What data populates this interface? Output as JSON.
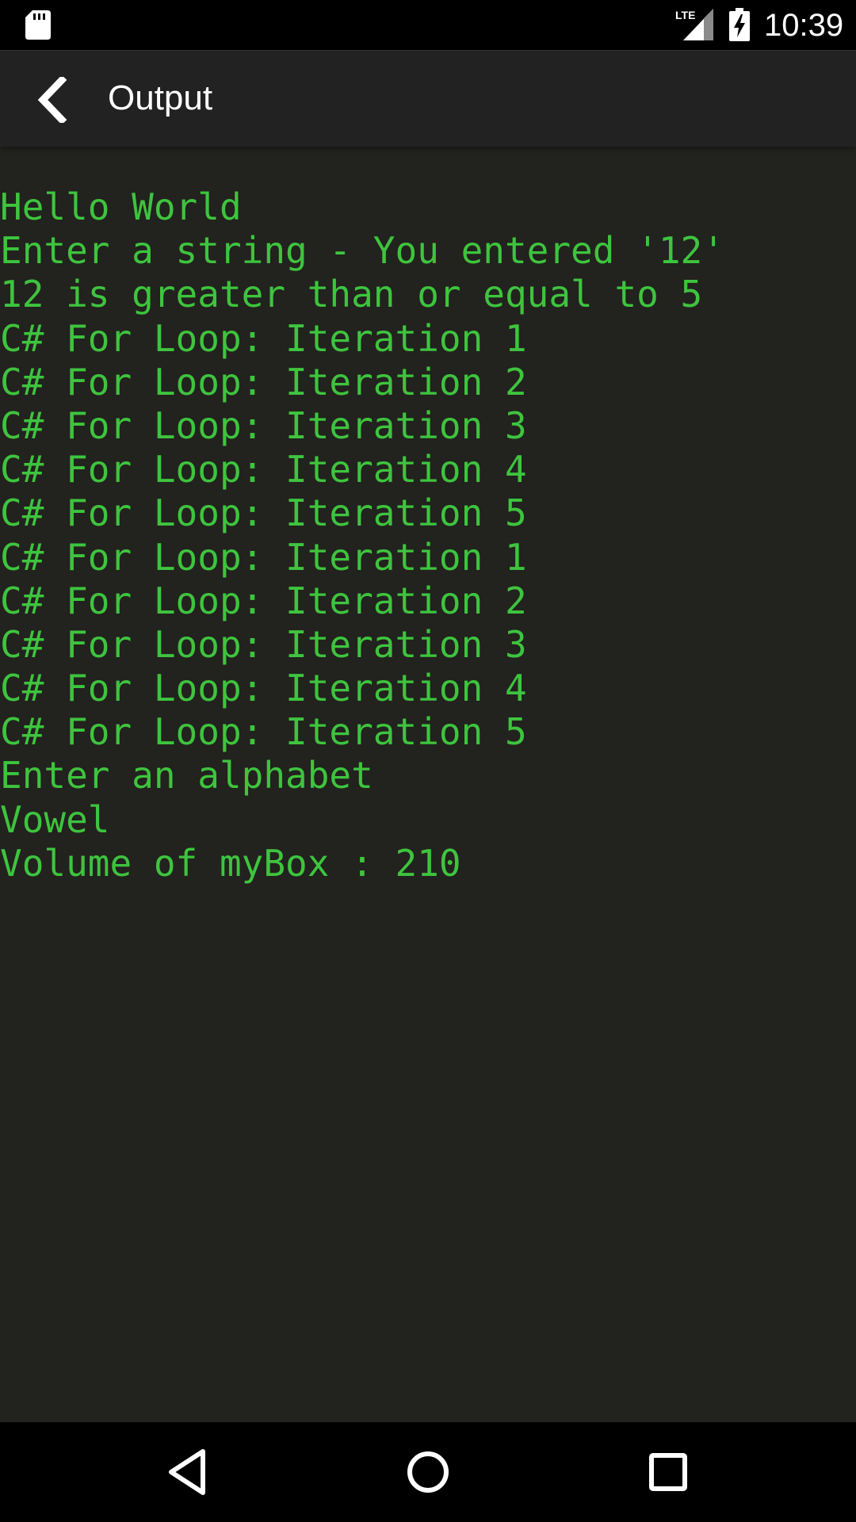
{
  "status_bar": {
    "time": "10:39",
    "network_label": "LTE",
    "icons": [
      "sd-card-icon",
      "lte-signal-icon",
      "battery-charging-icon"
    ]
  },
  "app_bar": {
    "title": "Output",
    "back_icon": "chevron-left-icon"
  },
  "console": {
    "text_color": "#3ec43e",
    "background_color": "#22221e",
    "lines": [
      "Hello World",
      "Enter a string - You entered '12'",
      "12 is greater than or equal to 5",
      "C# For Loop: Iteration 1",
      "C# For Loop: Iteration 2",
      "C# For Loop: Iteration 3",
      "C# For Loop: Iteration 4",
      "C# For Loop: Iteration 5",
      "C# For Loop: Iteration 1",
      "C# For Loop: Iteration 2",
      "C# For Loop: Iteration 3",
      "C# For Loop: Iteration 4",
      "C# For Loop: Iteration 5",
      "Enter an alphabet",
      "Vowel",
      "Volume of myBox : 210"
    ]
  },
  "nav_bar": {
    "buttons": [
      "back-triangle-icon",
      "home-circle-icon",
      "recents-square-icon"
    ]
  }
}
